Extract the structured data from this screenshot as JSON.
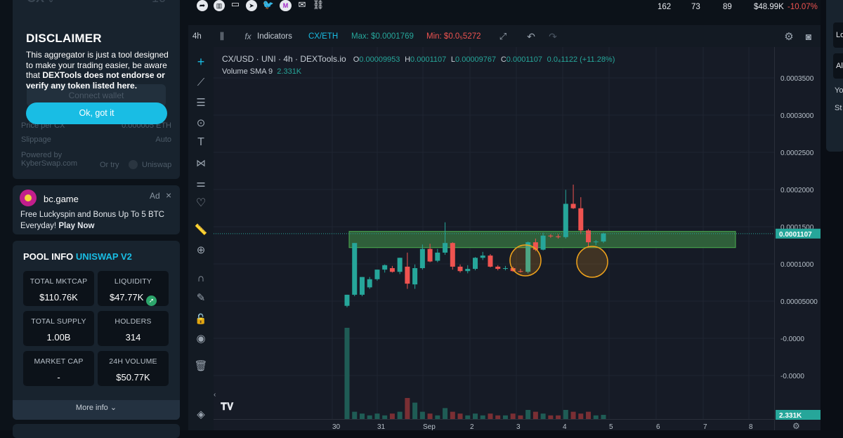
{
  "swap": {
    "token": "CX",
    "amount": "10",
    "connect_label": "Connect wallet",
    "price_label": "Price per CX",
    "price_value": "0.000005 ETH",
    "slippage_label": "Slippage",
    "slippage_value": "Auto",
    "powered_label": "Powered by",
    "powered_value": "KyberSwap.com",
    "or_try": "Or try",
    "uniswap": "Uniswap"
  },
  "disclaimer": {
    "title": "DISCLAIMER",
    "text_plain_1": "This aggregator is just a tool designed to make your trading easier, be aware that ",
    "text_bold": "DEXTools does not endorse or verify any token listed here.",
    "button": "Ok, got it"
  },
  "ad": {
    "name": "bc.game",
    "badge": "Ad",
    "close": "×",
    "text": "Free Luckyspin and Bonus Up To 5 BTC Everyday! ",
    "cta": "Play Now"
  },
  "pool": {
    "title_1": "POOL INFO ",
    "title_2": "UNISWAP V2",
    "stats": [
      {
        "label": "TOTAL MKTCAP",
        "value": "$110.76K"
      },
      {
        "label": "LIQUIDITY",
        "value": "$47.77K"
      },
      {
        "label": "TOTAL SUPPLY",
        "value": "1.00B"
      },
      {
        "label": "HOLDERS",
        "value": "314"
      },
      {
        "label": "MARKET CAP",
        "value": "-"
      },
      {
        "label": "24H VOLUME",
        "value": "$50.77K"
      }
    ],
    "more": "More info"
  },
  "topbar": {
    "stats": [
      "162",
      "73",
      "89",
      "$48.99K"
    ],
    "change": "-10.07%"
  },
  "toolbar": {
    "interval": "4h",
    "indicators": "Indicators",
    "pair": "CX/ETH",
    "max_label": "Max: $0.0001769",
    "min_label": "Min: $0.0₅5272"
  },
  "legend": {
    "symbol": "CX/USD · UNI · 4h · DEXTools.io",
    "o_label": "O",
    "o": "0.00009953",
    "h_label": "H",
    "h": "0.0001107",
    "l_label": "L",
    "l": "0.00009767",
    "c_label": "C",
    "c": "0.0001107",
    "chg": "0.0₄1122 (+11.28%)",
    "vol_label": "Volume SMA 9",
    "vol": "2.331K"
  },
  "colors": {
    "up": "#26a69a",
    "down": "#ef5350",
    "accent": "#19bde4"
  },
  "right": {
    "fa": "FA",
    "lo": "Lo",
    "al": "Al",
    "yo": "Yo",
    "st": "St"
  },
  "chart_data": {
    "type": "candlestick",
    "price_ticks": [
      "0.0003500",
      "0.0003000",
      "0.0002500",
      "0.0002000",
      "0.0001500",
      "0.0001000",
      "0.00005000",
      "-0.0000",
      "-0.0000"
    ],
    "last_price_label": "0.0001107",
    "volume_label": "2.331K",
    "x_ticks": [
      "30",
      "31",
      "Sep",
      "2",
      "3",
      "4",
      "5",
      "6",
      "7",
      "8"
    ],
    "ylim": [
      -7e-05,
      0.00039
    ],
    "zone": {
      "from": 9.18e-05,
      "to": 0.0001137
    },
    "candles": [
      [
        1.3e-05,
        2.8e-05,
        1.1e-05,
        2.8e-05
      ],
      [
        2.8e-05,
        9.8e-05,
        2.6e-05,
        9.8e-05
      ],
      [
        2.8e-05,
        5.2e-05,
        2.6e-05,
        5.2e-05
      ],
      [
        3.8e-05,
        5.2e-05,
        3.6e-05,
        4.9e-05
      ],
      [
        4.9e-05,
        6.2e-05,
        4.7e-05,
        6.2e-05
      ],
      [
        6.2e-05,
        6.9e-05,
        5.8e-05,
        6.8e-05
      ],
      [
        6.4e-05,
        6.7e-05,
        5.8e-05,
        5.9e-05
      ],
      [
        5.9e-05,
        7.8e-05,
        5.6e-05,
        7.8e-05
      ],
      [
        6.6e-05,
        8.5e-05,
        3.6e-05,
        4.3e-05
      ],
      [
        4.2e-05,
        6.9e-05,
        3.6e-05,
        6.4e-05
      ],
      [
        6.4e-05,
        9.6e-05,
        6.2e-05,
        9e-05
      ],
      [
        9e-05,
        9.7e-05,
        7.2e-05,
        7.3e-05
      ],
      [
        7.4e-05,
        9e-05,
        7.2e-05,
        8.5e-05
      ],
      [
        8.5e-05,
        0.000126,
        8.2e-05,
        9.8e-05
      ],
      [
        9.8e-05,
        9.9e-05,
        6.2e-05,
        6.6e-05
      ],
      [
        6.6e-05,
        6.9e-05,
        5.8e-05,
        6e-05
      ],
      [
        6e-05,
        6.8e-05,
        5.7e-05,
        6.3e-05
      ],
      [
        6.3e-05,
        7.9e-05,
        6.1e-05,
        7.8e-05
      ],
      [
        7.8e-05,
        8.6e-05,
        7.5e-05,
        8.1e-05
      ],
      [
        8.1e-05,
        8.3e-05,
        6.5e-05,
        6.6e-05
      ],
      [
        6.6e-05,
        6.8e-05,
        6.1e-05,
        6.3e-05
      ],
      [
        6.3e-05,
        6.7e-05,
        6.1e-05,
        6.4e-05
      ],
      [
        6.4e-05,
        6.6e-05,
        5.9e-05,
        6e-05
      ],
      [
        6e-05,
        6.3e-05,
        5.8e-05,
        5.9e-05
      ],
      [
        5.9e-05,
        0.0001,
        5.7e-05,
        9.9e-05
      ],
      [
        9.9e-05,
        0.000104,
        8.7e-05,
        8.9e-05
      ],
      [
        8.9e-05,
        0.000112,
        8.8e-05,
        0.000108
      ],
      [
        0.000108,
        0.00011,
        0.000105,
        0.000107
      ],
      [
        0.000107,
        0.00011,
        0.000104,
        0.000106
      ],
      [
        0.000106,
        0.00017,
        0.000104,
        0.000151
      ],
      [
        0.000151,
        0.000177,
        0.000144,
        0.000145
      ],
      [
        0.000145,
        0.00016,
        0.00011,
        0.000115
      ],
      [
        0.000115,
        0.000117,
        9.3e-05,
        9.9e-05
      ],
      [
        9.9e-05,
        0.000102,
        9.5e-05,
        0.0001
      ],
      [
        0.0001,
        0.000112,
        9.8e-05,
        0.000111
      ]
    ],
    "volumes": [
      0.05,
      0.004,
      0.003,
      0.002,
      0.003,
      0.002,
      0.003,
      0.004,
      0.012,
      0.009,
      0.004,
      0.003,
      0.002,
      0.006,
      0.004,
      0.003,
      0.002,
      0.003,
      0.002,
      0.003,
      0.002,
      0.002,
      0.003,
      0.002,
      0.005,
      0.004,
      0.003,
      0.002,
      0.002,
      0.005,
      0.004,
      0.003,
      0.004,
      0.002,
      0.0023
    ]
  }
}
